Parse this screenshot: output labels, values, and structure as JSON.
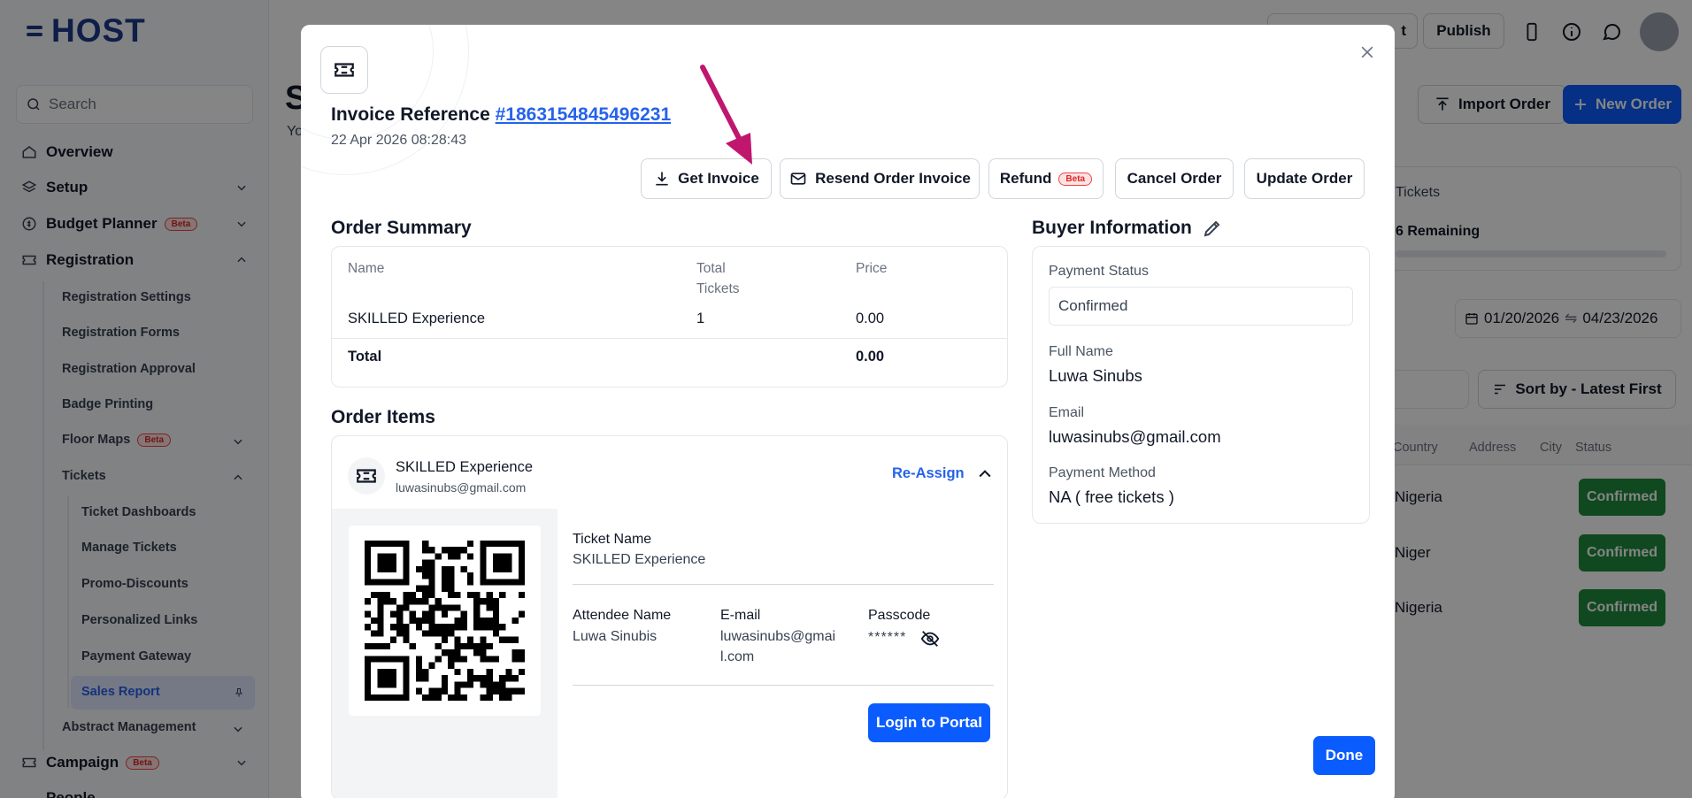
{
  "app": {
    "logo": "HOST",
    "search_placeholder": "Search"
  },
  "sidebar": {
    "items": [
      {
        "label": "Overview",
        "icon": "home-icon"
      },
      {
        "label": "Setup",
        "icon": "layers-icon"
      },
      {
        "label": "Budget Planner",
        "badge": "Beta",
        "icon": "dollar-circle-icon"
      },
      {
        "label": "Registration",
        "icon": "ticket-icon"
      }
    ],
    "registration_sub": [
      "Registration Settings",
      "Registration Forms",
      "Registration Approval",
      "Badge Printing"
    ],
    "floor_maps": {
      "label": "Floor Maps",
      "badge": "Beta"
    },
    "tickets_label": "Tickets",
    "tickets_sub": [
      "Ticket Dashboards",
      "Manage Tickets",
      "Promo-Discounts",
      "Personalized Links",
      "Payment Gateway",
      "Sales Report"
    ],
    "abstract": "Abstract Management",
    "campaign": {
      "label": "Campaign",
      "badge": "Beta"
    },
    "people": "People"
  },
  "topbar": {
    "publish": "Publish",
    "partial_btn": "t"
  },
  "background": {
    "page_title_partial": "S",
    "page_sub_partial": "Yo",
    "import_order": "Import Order",
    "new_order": "New Order",
    "tickets_card_title": "Tickets",
    "remaining": "6 Remaining",
    "date_from": "01/20/2026",
    "date_to": "04/23/2026",
    "sort": "Sort by - Latest First",
    "columns": [
      "Country",
      "Address",
      "City",
      "Status"
    ],
    "rows": [
      {
        "country": "Nigeria",
        "status": "Confirmed"
      },
      {
        "country": "Niger",
        "status": "Confirmed"
      },
      {
        "country": "Nigeria",
        "status": "Confirmed"
      }
    ]
  },
  "modal": {
    "invoice_ref_label": "Invoice Reference",
    "invoice_ref_number": "#1863154845496231",
    "date": "22 Apr 2026 08:28:43",
    "actions": {
      "get_invoice": "Get Invoice",
      "resend": "Resend Order Invoice",
      "refund": "Refund",
      "refund_badge": "Beta",
      "cancel": "Cancel Order",
      "update": "Update Order"
    },
    "order_summary": {
      "title": "Order Summary",
      "headers": {
        "name": "Name",
        "total_tickets_1": "Total",
        "total_tickets_2": "Tickets",
        "price": "Price"
      },
      "row": {
        "name": "SKILLED Experience",
        "qty": "1",
        "price": "0.00"
      },
      "total_label": "Total",
      "total_value": "0.00"
    },
    "buyer": {
      "title": "Buyer Information",
      "payment_status_label": "Payment Status",
      "payment_status": "Confirmed",
      "full_name_label": "Full Name",
      "full_name": "Luwa Sinubs",
      "email_label": "Email",
      "email": "luwasinubs@gmail.com",
      "payment_method_label": "Payment Method",
      "payment_method": "NA ( free tickets )"
    },
    "order_items": {
      "title": "Order Items",
      "item_name": "SKILLED Experience",
      "item_email": "luwasinubs@gmail.com",
      "reassign": "Re-Assign",
      "ticket_name_label": "Ticket Name",
      "ticket_name": "SKILLED Experience",
      "attendee_label": "Attendee Name",
      "attendee": "Luwa Sinubis",
      "email_label": "E-mail",
      "email_line1": "luwasinubs@gmai",
      "email_line2": "l.com",
      "passcode_label": "Passcode",
      "passcode": "******",
      "login": "Login to Portal"
    },
    "done": "Done"
  },
  "colors": {
    "primary": "#0b5cff",
    "brand": "#1e3a8a",
    "status_green": "#1f8a3c",
    "annotation_arrow": "#c0166e"
  }
}
